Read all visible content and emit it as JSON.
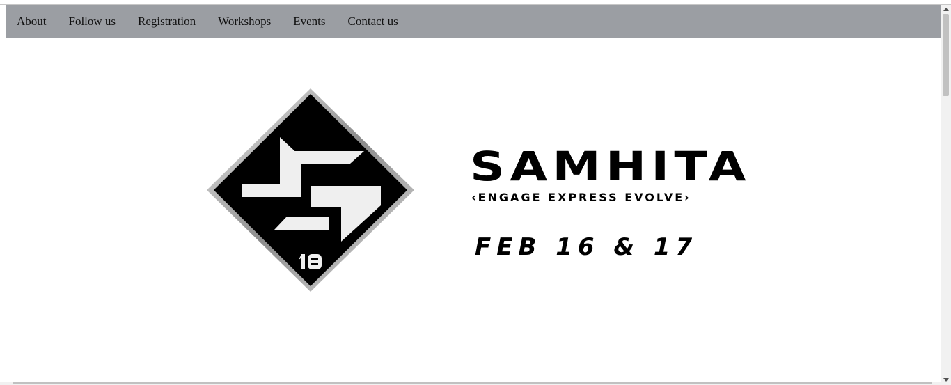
{
  "nav": {
    "items": [
      {
        "label": "About"
      },
      {
        "label": "Follow us"
      },
      {
        "label": "Registration"
      },
      {
        "label": "Workshops"
      },
      {
        "label": "Events"
      },
      {
        "label": "Contact us"
      }
    ]
  },
  "hero": {
    "logo_badge": "18",
    "title": "SAMHITA",
    "tagline": "‹ENGAGE EXPRESS EVOLVE›",
    "date": "FEB 16 & 17"
  },
  "colors": {
    "navbar_bg": "#9b9ea3",
    "logo_dark": "#000000",
    "logo_light": "#efefef",
    "text": "#000000"
  },
  "icons": {
    "logo": "samhita-s-diamond-logo",
    "scroll_up": "triangle-up-icon",
    "scroll_down": "triangle-down-icon"
  }
}
